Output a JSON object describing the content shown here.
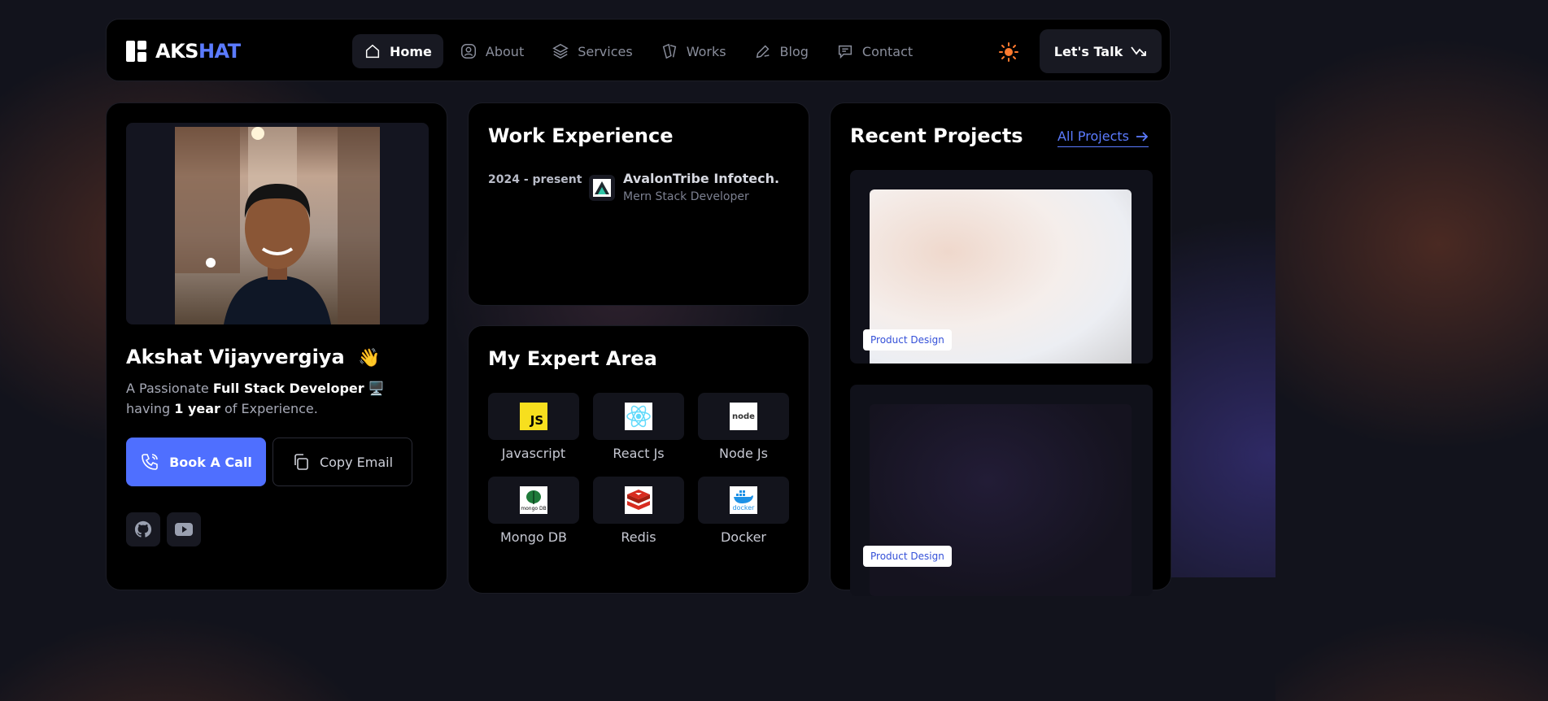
{
  "nav": {
    "logo_prefix": "AKS",
    "logo_suffix": "HAT",
    "items": [
      {
        "label": "Home",
        "icon": "home-icon",
        "active": true
      },
      {
        "label": "About",
        "icon": "user-icon",
        "active": false
      },
      {
        "label": "Services",
        "icon": "layers-icon",
        "active": false
      },
      {
        "label": "Works",
        "icon": "cards-icon",
        "active": false
      },
      {
        "label": "Blog",
        "icon": "pen-icon",
        "active": false
      },
      {
        "label": "Contact",
        "icon": "message-icon",
        "active": false
      }
    ],
    "cta_label": "Let's Talk"
  },
  "profile": {
    "name": "Akshat Vijayvergiya",
    "wave": "👋",
    "bio_prefix": "A Passionate ",
    "bio_role": "Full Stack Developer",
    "bio_emoji": "🖥️",
    "bio_mid": " having ",
    "bio_years": "1 year",
    "bio_suffix": " of Experience.",
    "call_label": "Book A Call",
    "copy_label": "Copy Email"
  },
  "work": {
    "title": "Work Experience",
    "period": "2024 - present",
    "company": "AvalonTribe Infotech.",
    "role": "Mern Stack Developer"
  },
  "expert": {
    "title": "My Expert Area",
    "skills": [
      "Javascript",
      "React Js",
      "Node Js",
      "Mongo DB",
      "Redis",
      "Docker"
    ],
    "logo_text": {
      "js": "JS",
      "node": "node",
      "mongo": "mongo DB",
      "docker": "docker"
    }
  },
  "projects": {
    "title": "Recent Projects",
    "all_label": "All Projects",
    "items": [
      {
        "badge": "Product Design"
      },
      {
        "badge": "Product Design"
      }
    ]
  },
  "colors": {
    "accent": "#4f6fff",
    "sun": "#ff7a2f"
  }
}
